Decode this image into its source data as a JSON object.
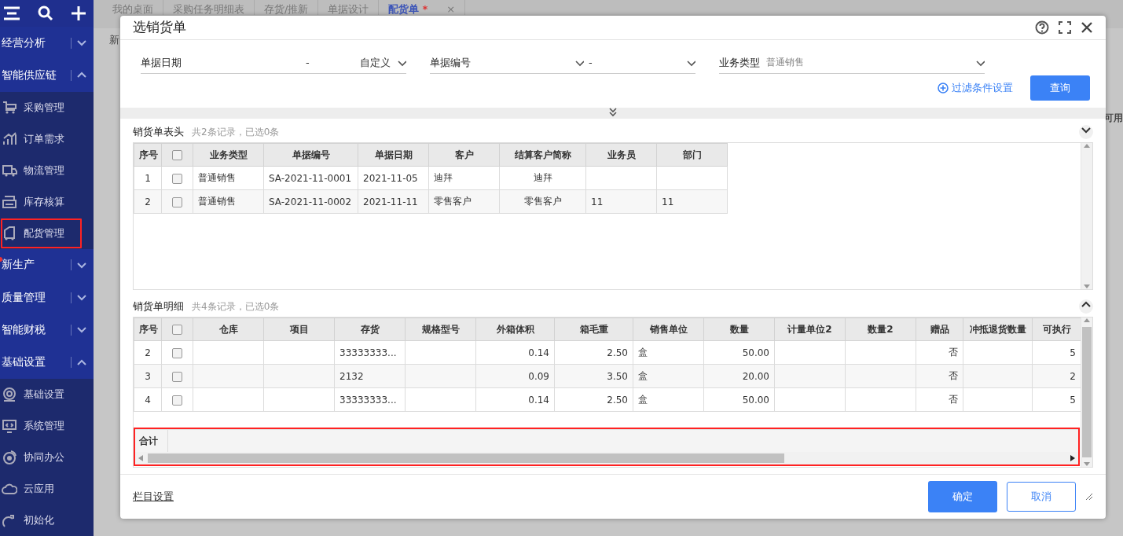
{
  "sidebar": {
    "groups": [
      {
        "label": "经营分析",
        "expanded": false
      },
      {
        "label": "智能供应链",
        "expanded": true,
        "children": [
          {
            "label": "采购管理",
            "highlighted": false
          },
          {
            "label": "订单需求",
            "highlighted": false
          },
          {
            "label": "物流管理",
            "highlighted": false
          },
          {
            "label": "库存核算",
            "highlighted": false
          },
          {
            "label": "配货管理",
            "highlighted": true
          }
        ]
      },
      {
        "label": "新生产",
        "expanded": false,
        "dot": true
      },
      {
        "label": "质量管理",
        "expanded": false
      },
      {
        "label": "智能财税",
        "expanded": false
      },
      {
        "label": "基础设置",
        "expanded": true,
        "children": [
          {
            "label": "基础设置",
            "highlighted": false
          },
          {
            "label": "系统管理",
            "highlighted": false
          },
          {
            "label": "协同办公",
            "highlighted": false
          },
          {
            "label": "云应用",
            "highlighted": false
          },
          {
            "label": "初始化",
            "highlighted": false
          }
        ]
      }
    ]
  },
  "tabs": [
    {
      "label": "我的桌面",
      "selected": false
    },
    {
      "label": "采购任务明细表",
      "selected": false
    },
    {
      "label": "存货/推新",
      "selected": false
    },
    {
      "label": "单据设计",
      "selected": false
    },
    {
      "label": "配货单",
      "selected": true,
      "mark": "*",
      "close": "×"
    }
  ],
  "background": {
    "toolbar_text": "新",
    "column_text": "可用"
  },
  "dialog": {
    "title": "选销货单",
    "filters": [
      {
        "label": "单据日期",
        "kind": "date",
        "from": "-",
        "mode": "自定义"
      },
      {
        "label": "单据编号",
        "kind": "range",
        "separator": "-"
      },
      {
        "label": "业务类型",
        "kind": "select",
        "placeholder": "普通销售"
      }
    ],
    "filter_settings": "过滤条件设置",
    "query_button": "查询",
    "sections": [
      {
        "title": "销货单表头",
        "summary": "共2条记录，已选0条",
        "expanded": true,
        "all_checked": false,
        "columns": [
          {
            "label": "序号"
          },
          {
            "kind": "check"
          },
          {
            "label": "业务类型"
          },
          {
            "label": "单据编号"
          },
          {
            "label": "单据日期"
          },
          {
            "label": "客户"
          },
          {
            "label": "结算客户简称"
          },
          {
            "label": "业务员"
          },
          {
            "label": "部门"
          }
        ],
        "rows": [
          {
            "checked": false,
            "cells": [
              "1",
              "",
              "普通销售",
              "SA-2021-11-0001",
              "2021-11-05",
              "迪拜",
              "迪拜",
              "",
              ""
            ]
          },
          {
            "checked": false,
            "cells": [
              "2",
              "",
              "普通销售",
              "SA-2021-11-0002",
              "2021-11-11",
              "零售客户",
              "零售客户",
              "11",
              "11"
            ]
          }
        ]
      },
      {
        "title": "销货单明细",
        "summary": "共4条记录，已选0条",
        "expanded": false,
        "all_checked": false,
        "total_row": "合计",
        "columns": [
          {
            "label": "序号"
          },
          {
            "kind": "check"
          },
          {
            "label": "仓库"
          },
          {
            "label": "项目"
          },
          {
            "label": "存货"
          },
          {
            "label": "规格型号"
          },
          {
            "label": "外箱体积"
          },
          {
            "label": "箱毛重"
          },
          {
            "label": "销售单位"
          },
          {
            "label": "数量"
          },
          {
            "label": "计量单位2"
          },
          {
            "label": "数量2"
          },
          {
            "label": "赠品"
          },
          {
            "label": "冲抵退货数量"
          },
          {
            "label": "可执行"
          }
        ],
        "rows": [
          {
            "checked": false,
            "cells": [
              "2",
              "",
              "",
              "",
              "33333333...",
              "",
              "0.14",
              "2.50",
              "盒",
              "50.00",
              "",
              "",
              "否",
              "",
              "5"
            ]
          },
          {
            "checked": false,
            "cells": [
              "3",
              "",
              "",
              "",
              "2132",
              "",
              "0.09",
              "3.50",
              "盒",
              "20.00",
              "",
              "",
              "否",
              "",
              "2"
            ]
          },
          {
            "checked": false,
            "cells": [
              "4",
              "",
              "",
              "",
              "33333333...",
              "",
              "0.14",
              "2.50",
              "盒",
              "50.00",
              "",
              "",
              "否",
              "",
              "5"
            ]
          }
        ]
      }
    ],
    "column_settings": "栏目设置",
    "confirm_button": "确定",
    "cancel_button": "取消"
  }
}
